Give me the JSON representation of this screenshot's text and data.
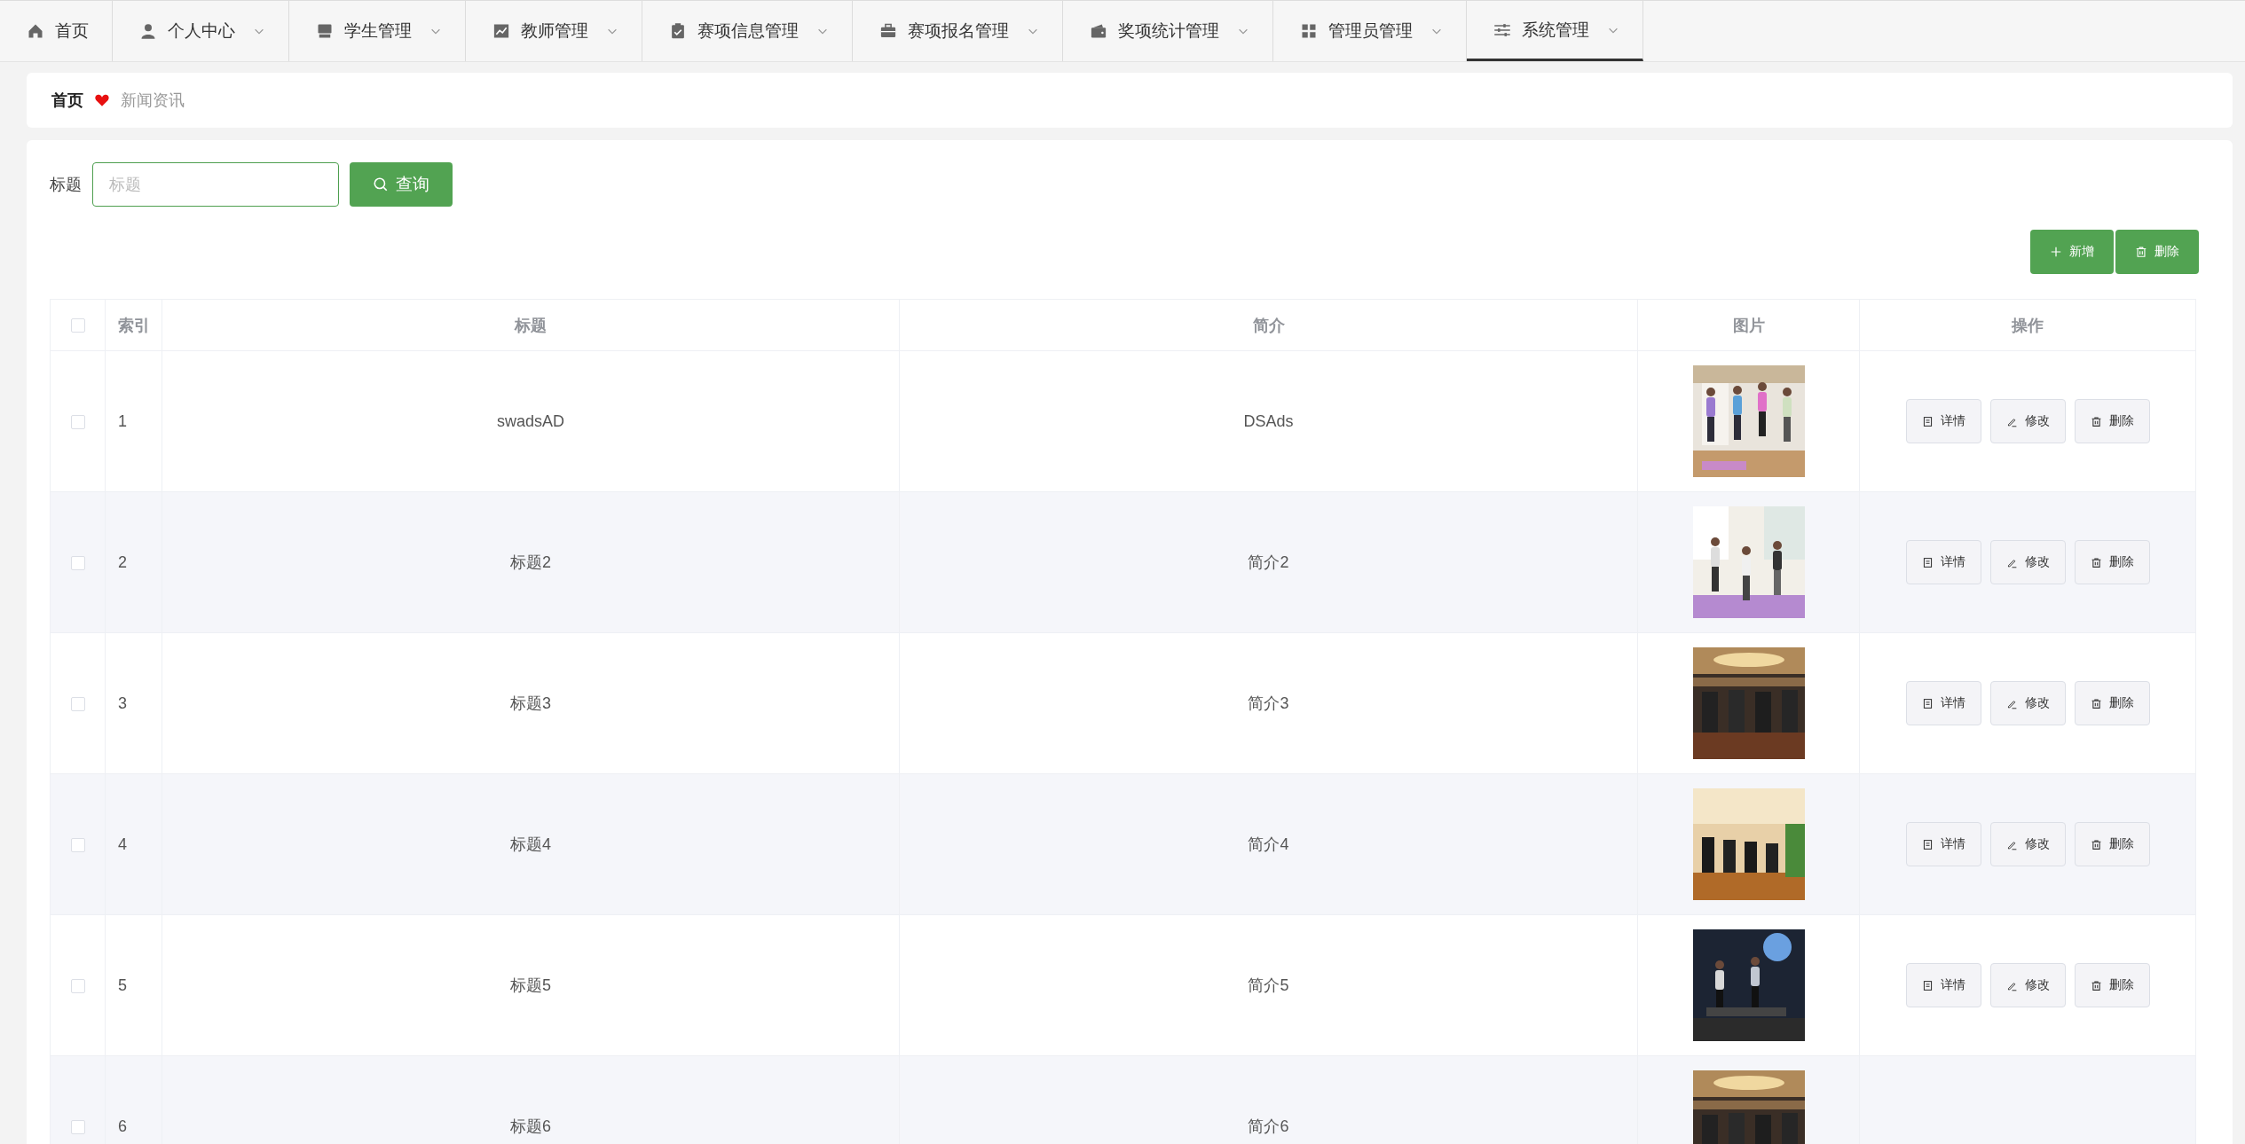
{
  "nav": [
    {
      "label": "首页",
      "dropdown": false,
      "selected": false
    },
    {
      "label": "个人中心",
      "dropdown": true,
      "selected": false
    },
    {
      "label": "学生管理",
      "dropdown": true,
      "selected": false
    },
    {
      "label": "教师管理",
      "dropdown": true,
      "selected": false
    },
    {
      "label": "赛项信息管理",
      "dropdown": true,
      "selected": false
    },
    {
      "label": "赛项报名管理",
      "dropdown": true,
      "selected": false
    },
    {
      "label": "奖项统计管理",
      "dropdown": true,
      "selected": false
    },
    {
      "label": "管理员管理",
      "dropdown": true,
      "selected": false
    },
    {
      "label": "系统管理",
      "dropdown": true,
      "selected": true
    }
  ],
  "breadcrumb": {
    "home": "首页",
    "current": "新闻资讯"
  },
  "search": {
    "label": "标题",
    "placeholder": "标题",
    "button": "查询"
  },
  "toolbar": [
    {
      "label": "新增"
    },
    {
      "label": "删除"
    }
  ],
  "table": {
    "select_all_checked": false,
    "columns": [
      "索引",
      "标题",
      "简介",
      "图片",
      "操作"
    ],
    "rows": [
      {
        "checked": false,
        "index": "1",
        "title": "swadsAD",
        "intro": "DSAds",
        "actions": [
          {
            "label": "详情"
          },
          {
            "label": "修改"
          },
          {
            "label": "删除"
          }
        ]
      },
      {
        "checked": false,
        "index": "2",
        "title": "标题2",
        "intro": "简介2",
        "actions": [
          {
            "label": "详情"
          },
          {
            "label": "修改"
          },
          {
            "label": "删除"
          }
        ]
      },
      {
        "checked": false,
        "index": "3",
        "title": "标题3",
        "intro": "简介3",
        "actions": [
          {
            "label": "详情"
          },
          {
            "label": "修改"
          },
          {
            "label": "删除"
          }
        ]
      },
      {
        "checked": false,
        "index": "4",
        "title": "标题4",
        "intro": "简介4",
        "actions": [
          {
            "label": "详情"
          },
          {
            "label": "修改"
          },
          {
            "label": "删除"
          }
        ]
      },
      {
        "checked": false,
        "index": "5",
        "title": "标题5",
        "intro": "简介5",
        "actions": [
          {
            "label": "详情"
          },
          {
            "label": "修改"
          },
          {
            "label": "删除"
          }
        ]
      },
      {
        "checked": false,
        "index": "6",
        "title": "标题6",
        "intro": "简介6"
      }
    ]
  }
}
